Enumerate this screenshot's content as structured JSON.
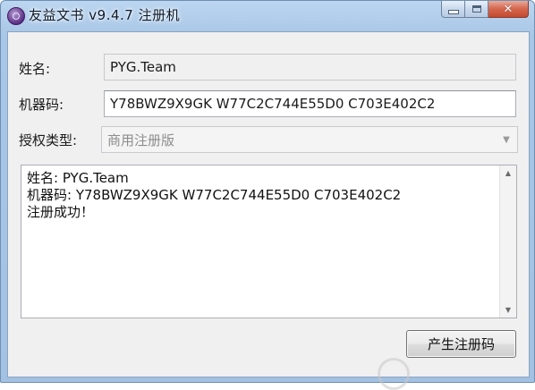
{
  "window": {
    "title": "友益文书 v9.4.7 注册机"
  },
  "form": {
    "name_label": "姓名:",
    "name_value": "PYG.Team",
    "machine_label": "机器码:",
    "machine_value": "Y78BWZ9X9GK W77C2C744E55D0 C703E402C2",
    "license_label": "授权类型:",
    "license_value": "商用注册版"
  },
  "output": {
    "lines": [
      "姓名: PYG.Team",
      "机器码: Y78BWZ9X9GK W77C2C744E55D0 C703E402C2",
      "注册成功！"
    ]
  },
  "actions": {
    "generate_label": "产生注册码"
  },
  "icons": {
    "app": "app-logo-icon",
    "minimize": "minimize-icon",
    "maximize": "maximize-icon",
    "close": "close-icon",
    "dropdown": "chevron-down-icon",
    "scroll_up": "scroll-up-icon",
    "scroll_down": "scroll-down-icon"
  },
  "colors": {
    "titlebar": "#a8c6e6",
    "close_button": "#d4654e",
    "client_bg": "#f0f0f0"
  }
}
